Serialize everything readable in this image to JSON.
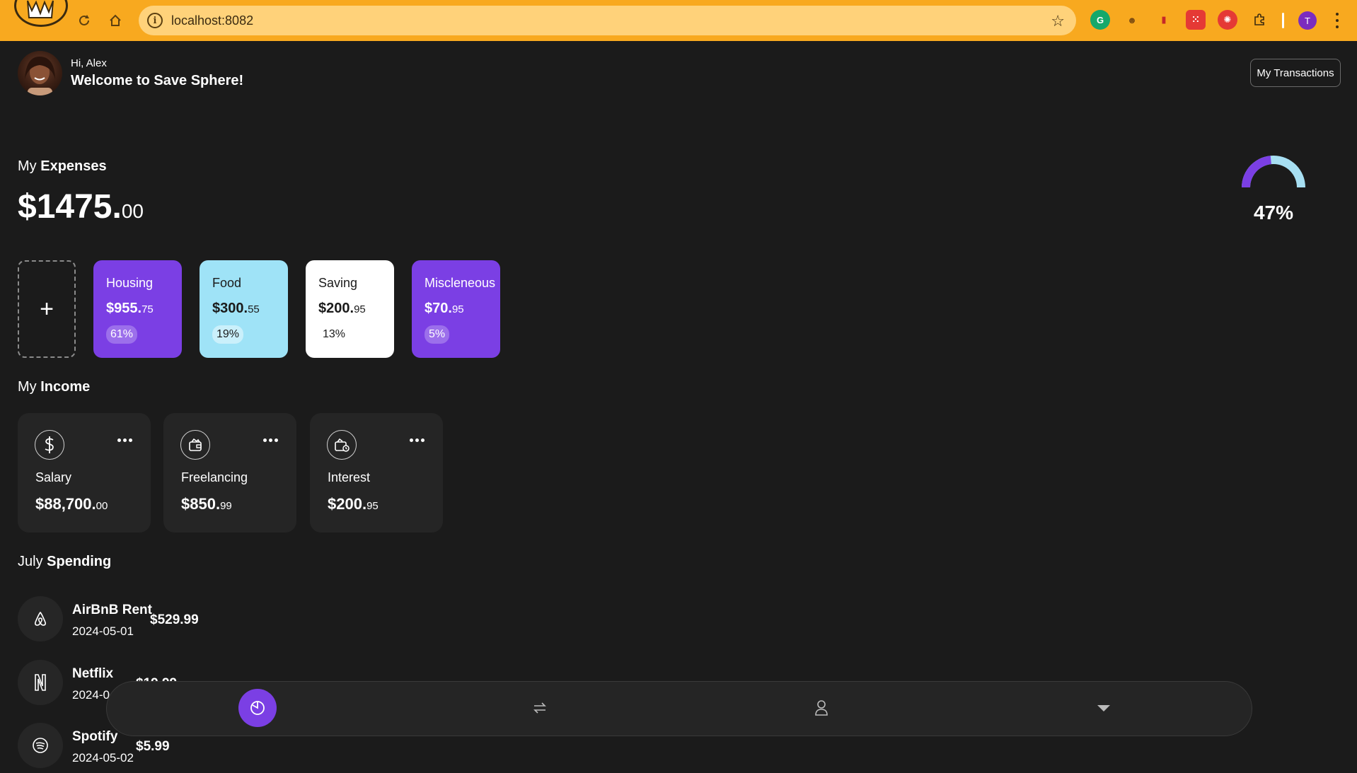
{
  "browser": {
    "url": "localhost:8082",
    "profile_initial": "T",
    "accent": "#f8a91f"
  },
  "header": {
    "greeting": "Hi, Alex",
    "welcome": "Welcome to Save Sphere!",
    "transactions_button": "My Transactions"
  },
  "expenses": {
    "title_prefix": "My",
    "title_bold": "Expenses",
    "total_whole": "$1475.",
    "total_cents": "00",
    "gauge_percent": "47%",
    "gauge_value": 0.47,
    "add_label": "+",
    "categories": [
      {
        "name": "Housing",
        "amount_whole": "$955.",
        "amount_cents": "75",
        "percent": "61%",
        "bg": "#7b3fe4",
        "fg": "#ffffff"
      },
      {
        "name": "Food",
        "amount_whole": "$300.",
        "amount_cents": "55",
        "percent": "19%",
        "bg": "#9fe3f7",
        "fg": "#1b1b1b"
      },
      {
        "name": "Saving",
        "amount_whole": "$200.",
        "amount_cents": "95",
        "percent": "13%",
        "bg": "#ffffff",
        "fg": "#1b1b1b"
      },
      {
        "name": "Miscleneous",
        "amount_whole": "$70.",
        "amount_cents": "95",
        "percent": "5%",
        "bg": "#7b3fe4",
        "fg": "#ffffff"
      }
    ]
  },
  "income": {
    "title_prefix": "My",
    "title_bold": "Income",
    "items": [
      {
        "name": "Salary",
        "amount_whole": "$88,700.",
        "amount_cents": "00",
        "icon": "dollar-icon"
      },
      {
        "name": "Freelancing",
        "amount_whole": "$850.",
        "amount_cents": "99",
        "icon": "wallet-icon"
      },
      {
        "name": "Interest",
        "amount_whole": "$200.",
        "amount_cents": "95",
        "icon": "wallet-interest-icon"
      }
    ]
  },
  "spending": {
    "title_prefix": "July",
    "title_bold": "Spending",
    "items": [
      {
        "name": "AirBnB Rent",
        "date": "2024-05-01",
        "amount": "$529.99",
        "icon": "airbnb-icon"
      },
      {
        "name": "Netflix",
        "date": "2024-0",
        "amount": "$19.99",
        "icon": "netflix-icon"
      },
      {
        "name": "Spotify",
        "date": "2024-05-02",
        "amount": "$5.99",
        "icon": "spotify-icon"
      }
    ]
  },
  "nav": {
    "items": [
      "dashboard-icon",
      "transfer-icon",
      "profile-icon",
      "chevron-down-icon"
    ],
    "active_color": "#7b3fe4"
  }
}
